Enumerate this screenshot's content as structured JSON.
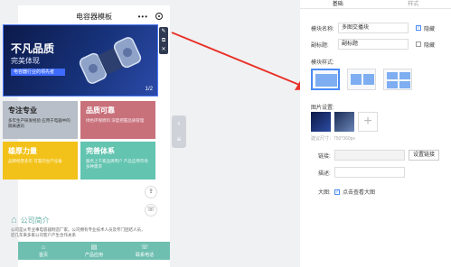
{
  "phone": {
    "title": "电容器模板",
    "menu_dots": "•••",
    "banner": {
      "title": "不凡品质",
      "subtitle": "完美体现",
      "tag": "电容器行业的领先者",
      "page": "1/2"
    },
    "cards": [
      {
        "title": "专注专业",
        "desc": "多年生产研发经验 应用于电器中的隔离通讯"
      },
      {
        "title": "品质可靠",
        "desc": "绿色环保原料 深度把握品质管理"
      },
      {
        "title": "雄厚力量",
        "desc": "品牌经营多年 可靠的生产设备"
      },
      {
        "title": "完善体系",
        "desc": "服务上千家品牌用户 产品应用市场多种需求"
      }
    ],
    "about_title": "公司简介",
    "intro": "公司是从专业事电容器制造厂家。公司拥有专业技术人员及专门团结人员，近几年来多家公司客户产生合作关系",
    "tabs": [
      {
        "label": "首页",
        "icon": "⌂"
      },
      {
        "label": "产品应用",
        "icon": "▤"
      },
      {
        "label": "联系电话",
        "icon": "☏"
      }
    ]
  },
  "tools": [
    "✎",
    "⧉",
    "✕"
  ],
  "panel": {
    "tabs": [
      "基础",
      "样式"
    ],
    "module_name_label": "模块名称:",
    "module_name_value": "多图交播块",
    "hide_label": "隐藏",
    "subtitle_label": "副标题:",
    "subtitle_value": "副标题",
    "style_label": "模块样式:",
    "image_label": "图片设置:",
    "size_hint": "建议尺寸：750*360px",
    "link_label": "链接:",
    "link_button": "设置链接",
    "desc_label": "描述:",
    "bigimg_label": "大图:",
    "bigimg_option": "点击查看大图"
  }
}
